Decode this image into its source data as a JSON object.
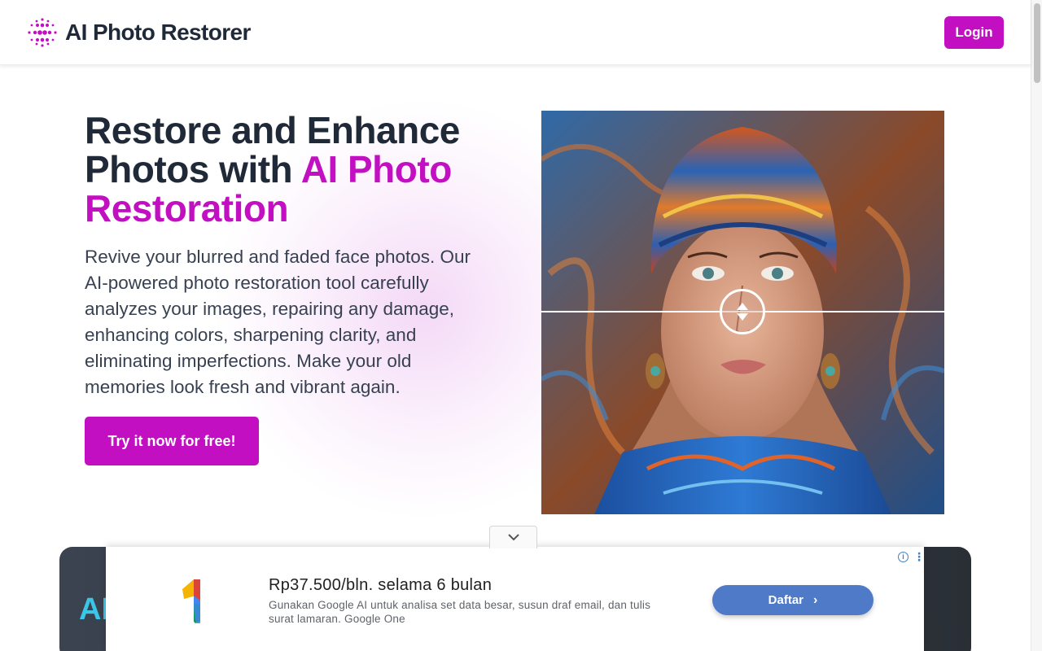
{
  "header": {
    "brand": "AI Photo Restorer",
    "login_label": "Login"
  },
  "hero": {
    "title_plain": "Restore and Enhance Photos with ",
    "title_accent": "AI Photo Restoration",
    "description": "Revive your blurred and faded face photos. Our AI-powered photo restoration tool carefully analyzes your images, repairing any damage, enhancing colors, sharpening clarity, and eliminating imperfections. Make your old memories look fresh and vibrant again.",
    "cta_label": "Try it now for free!"
  },
  "section": {
    "heading_partial": "AI"
  },
  "ad": {
    "headline": "Rp37.500/bln. selama 6 bulan",
    "body": "Gunakan Google AI untuk analisa set data besar, susun draf email, dan tulis surat lamaran. Google One",
    "cta_label": "Daftar",
    "cta_chevron": "›"
  },
  "colors": {
    "brand": "#c30fc2",
    "heading": "#1f2937",
    "ad_button": "#4e7ac7",
    "section_accent": "#3bc5e6"
  }
}
